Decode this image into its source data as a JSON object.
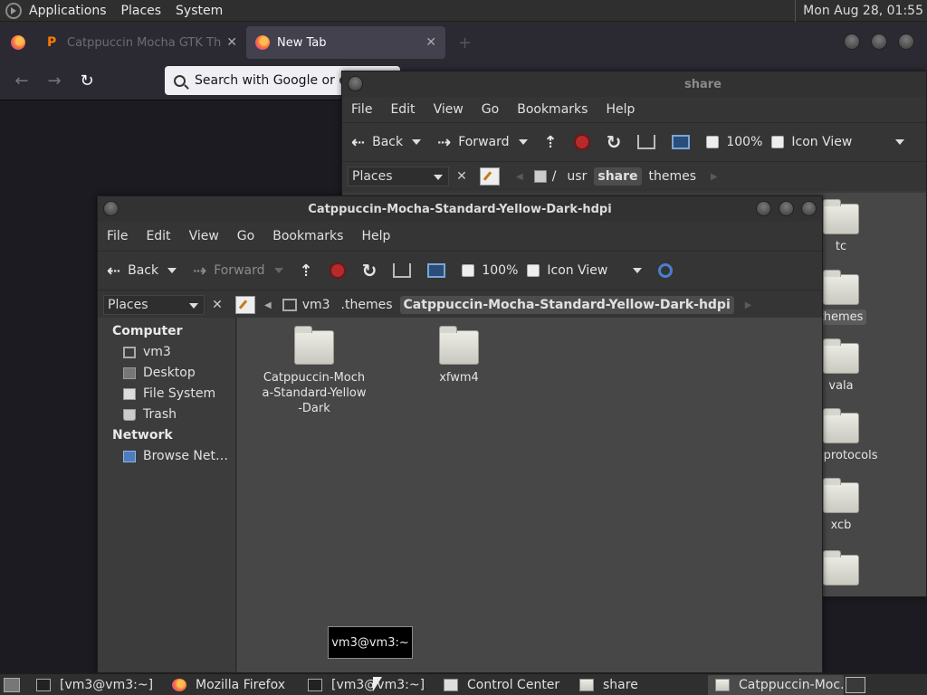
{
  "top_panel": {
    "menus": [
      "Applications",
      "Places",
      "System"
    ],
    "clock": "Mon Aug 28, 01:55"
  },
  "firefox": {
    "tabs": [
      {
        "label": "Catppuccin Mocha GTK Th",
        "active": false
      },
      {
        "label": "New Tab",
        "active": true
      }
    ],
    "url_placeholder": "Search with Google or enter address"
  },
  "back_window": {
    "title": "share",
    "menus": [
      "File",
      "Edit",
      "View",
      "Go",
      "Bookmarks",
      "Help"
    ],
    "toolbar": {
      "back": "Back",
      "forward": "Forward",
      "zoom": "100%",
      "view": "Icon View"
    },
    "places": "Places",
    "path": [
      "usr",
      "share",
      "themes"
    ],
    "active_crumb": "share",
    "items": [
      "tc",
      "themes",
      "vala",
      "nd-protocols",
      "xcb"
    ]
  },
  "front_window": {
    "title": "Catppuccin-Mocha-Standard-Yellow-Dark-hdpi",
    "menus": [
      "File",
      "Edit",
      "View",
      "Go",
      "Bookmarks",
      "Help"
    ],
    "toolbar": {
      "back": "Back",
      "forward": "Forward",
      "zoom": "100%",
      "view": "Icon View"
    },
    "places": "Places",
    "path": [
      "vm3",
      ".themes",
      "Catppuccin-Mocha-Standard-Yellow-Dark-hdpi"
    ],
    "sidebar": {
      "computer_header": "Computer",
      "computer_items": [
        "vm3",
        "Desktop",
        "File System",
        "Trash"
      ],
      "network_header": "Network",
      "network_items": [
        "Browse Net…"
      ]
    },
    "files": [
      {
        "name": "Catppuccin-Mocha-Standard-Yellow-Dark"
      },
      {
        "name": "xfwm4"
      }
    ]
  },
  "tooltip": "vm3@vm3:~",
  "taskbar": {
    "tasks": [
      {
        "label": "[vm3@vm3:~]",
        "icon": "terminal-icon",
        "active": false
      },
      {
        "label": "Mozilla Firefox",
        "icon": "firefox-icon",
        "active": false
      },
      {
        "label": "[vm3@vm3:~]",
        "icon": "terminal-icon",
        "active": false
      },
      {
        "label": "Control Center",
        "icon": "control-center-icon",
        "active": false
      },
      {
        "label": "share",
        "icon": "folder-icon",
        "active": false
      },
      {
        "label": "Catppuccin-Moc…",
        "icon": "folder-icon",
        "active": true
      }
    ]
  }
}
